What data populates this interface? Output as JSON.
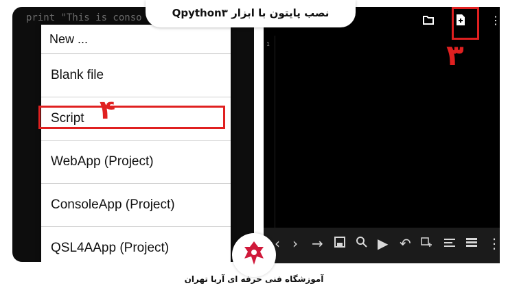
{
  "title": "نصب پایتون با ابزار Qpython۳",
  "left": {
    "code_line": "print \"This is conso",
    "menu": {
      "header": "New ...",
      "items": [
        "Blank file",
        "Script",
        "WebApp (Project)",
        "ConsoleApp (Project)",
        "QSL4AApp (Project)"
      ]
    },
    "step_label": "۴"
  },
  "right": {
    "line_number": "1",
    "step_label": "۳",
    "top_icons": [
      "folder-icon",
      "new-file-icon",
      "more-icon"
    ],
    "toolbar_icons": [
      "chevron-left-icon",
      "chevron-right-icon",
      "arrow-right-icon",
      "save-icon",
      "search-icon",
      "play-icon",
      "undo-icon",
      "snippet-icon",
      "align-icon",
      "list-icon",
      "more-icon"
    ]
  },
  "footer": "آموزشگاه فنی حرفه ای آریا تهران",
  "colors": {
    "accent": "#e02020",
    "editor_bg": "#000000",
    "toolbar_bg": "#1b1b1b"
  }
}
